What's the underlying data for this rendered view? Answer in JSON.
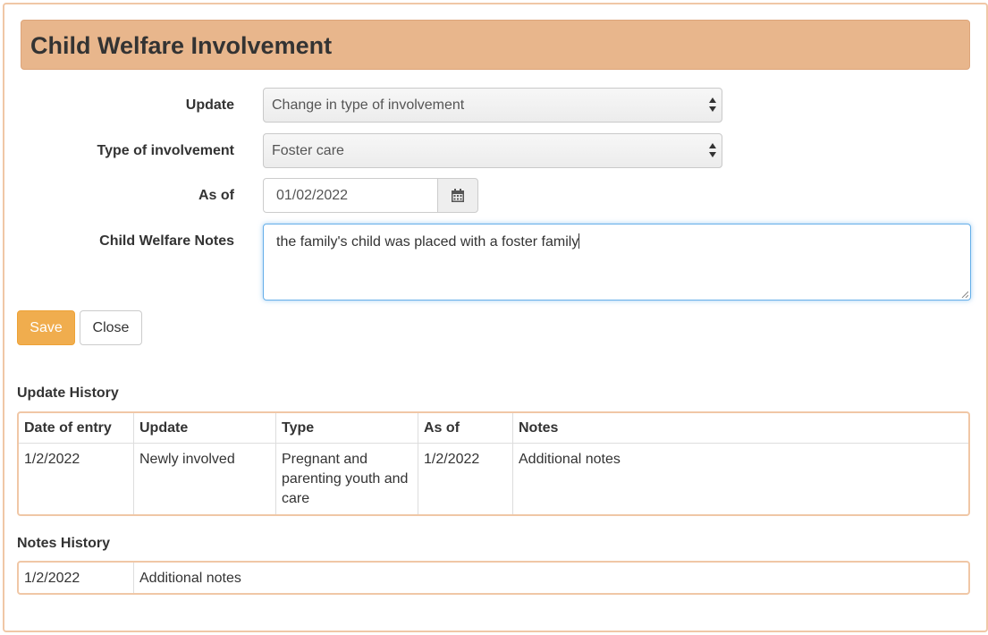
{
  "panel": {
    "title": "Child Welfare Involvement"
  },
  "form": {
    "update": {
      "label": "Update",
      "value": "Change in type of involvement"
    },
    "type": {
      "label": "Type of involvement",
      "value": "Foster care"
    },
    "as_of": {
      "label": "As of",
      "value": "01/02/2022"
    },
    "notes": {
      "label": "Child Welfare Notes",
      "value": "the family's child was placed with a foster family"
    }
  },
  "buttons": {
    "save": "Save",
    "close": "Close"
  },
  "update_history": {
    "title": "Update History",
    "columns": [
      "Date of entry",
      "Update",
      "Type",
      "As of",
      "Notes"
    ],
    "rows": [
      [
        "1/2/2022",
        "Newly involved",
        "Pregnant and parenting youth and care",
        "1/2/2022",
        "Additional notes"
      ]
    ]
  },
  "notes_history": {
    "title": "Notes History",
    "rows": [
      [
        "1/2/2022",
        "Additional notes"
      ]
    ]
  },
  "icons": {
    "date_picker": "calendar-icon",
    "select_arrows": "sort-arrows-icon",
    "resize": "resize-grip-icon"
  },
  "colors": {
    "header_bg": "#e8b68c",
    "save_button": "#f0ad4e",
    "panel_border": "#f0c7a6",
    "focus_border": "#66afe9"
  }
}
